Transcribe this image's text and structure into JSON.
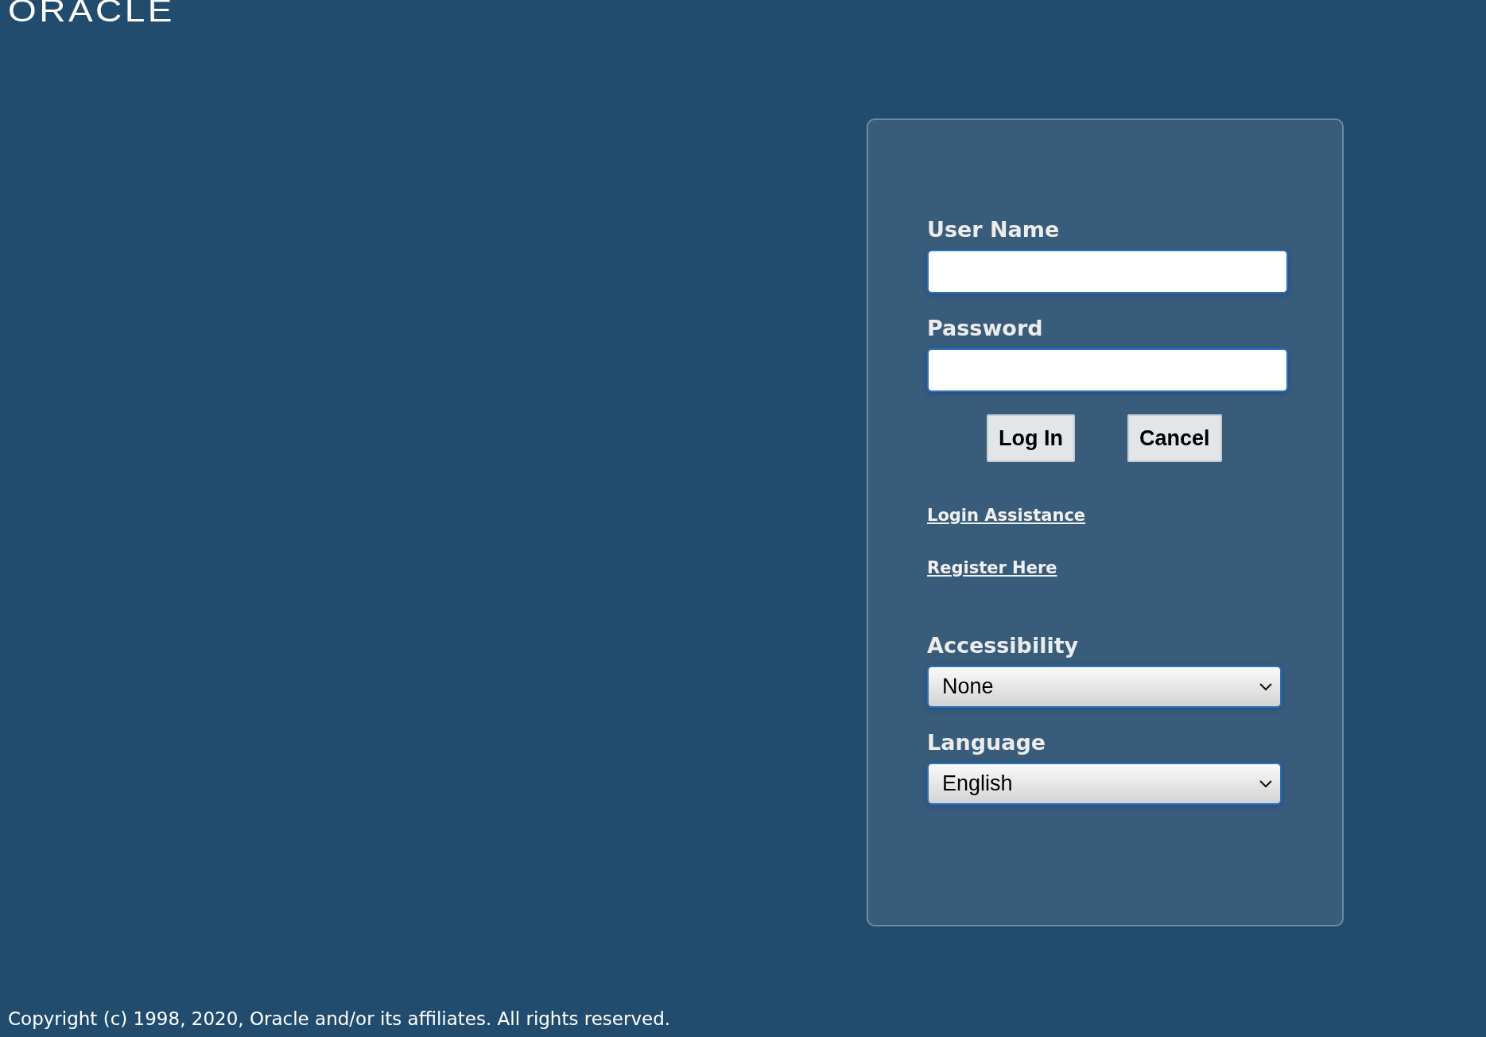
{
  "logo": "ORACLE",
  "form": {
    "fields": [
      {
        "label": "User Name"
      },
      {
        "label": "Password"
      }
    ],
    "buttons": [
      "Log In",
      "Cancel"
    ],
    "links": [
      "Login Assistance",
      "Register Here"
    ],
    "selects": [
      {
        "label": "Accessibility",
        "value": "None"
      },
      {
        "label": "Language",
        "value": "English"
      }
    ]
  },
  "copyright": "Copyright (c) 1998, 2020, Oracle and/or its affiliates. All rights reserved."
}
